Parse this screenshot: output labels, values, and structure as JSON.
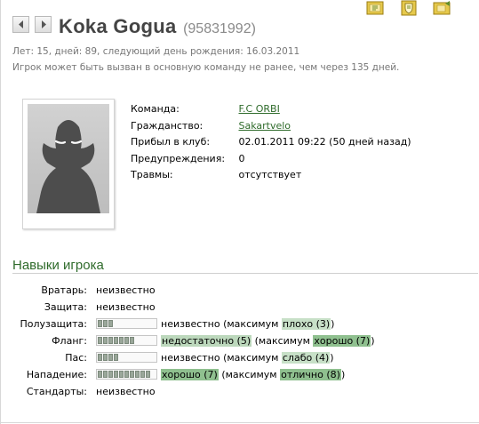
{
  "player": {
    "name": "Koka Gogua",
    "id_text": "(95831992)",
    "age_line": "Лет: 15, дней: 89, следующий день рождения: 16.03.2011",
    "eligibility_line": "Игрок может быть вызван в основную команду не ранее, чем через 135 дней."
  },
  "icons": {
    "prev": "arrow-left-icon",
    "next": "arrow-right-icon",
    "toolbar": [
      "folder-tool-icon",
      "shield-doc-icon",
      "folder-export-icon"
    ],
    "photo": "player-silhouette-icon"
  },
  "details": {
    "team_label": "Команда:",
    "team_value": "F.C ORBI",
    "citizenship_label": "Гражданство:",
    "citizenship_value": "Sakartvelo",
    "arrived_label": "Прибыл в клуб:",
    "arrived_value": "02.01.2011 09:22 (50 дней назад)",
    "warnings_label": "Предупреждения:",
    "warnings_value": "0",
    "injuries_label": "Травмы:",
    "injuries_value": "отсутствует"
  },
  "skills_title": "Навыки игрока",
  "skills": [
    {
      "label": "Вратарь:",
      "level_text": "неизвестно"
    },
    {
      "label": "Защита:",
      "level_text": "неизвестно"
    },
    {
      "label": "Полузащита:",
      "bar_filled": 3,
      "level_text": "неизвестно",
      "open_paren": "(максимум",
      "max_text": "плохо (3)",
      "close_paren": ")"
    },
    {
      "label": "Фланг:",
      "bar_filled": 7,
      "level_text": "недостаточно (5)",
      "open_paren": "(максимум",
      "max_text": "хорошо (7)",
      "close_paren": ")"
    },
    {
      "label": "Пас:",
      "bar_filled": 4,
      "level_text": "неизвестно",
      "open_paren": "(максимум",
      "max_text": "слабо (4)",
      "close_paren": ")"
    },
    {
      "label": "Нападение:",
      "bar_filled": 10,
      "level_text": "хорошо (7)",
      "open_paren": "(максимум",
      "max_text": "отлично (8)",
      "close_paren": ")"
    },
    {
      "label": "Стандарты:",
      "level_text": "неизвестно"
    }
  ],
  "colors": {
    "link": "#2f6b2b",
    "highlight_low": "#c7e0c7",
    "highlight_mid": "#bcd8bc",
    "highlight_good": "#8fc08f"
  }
}
